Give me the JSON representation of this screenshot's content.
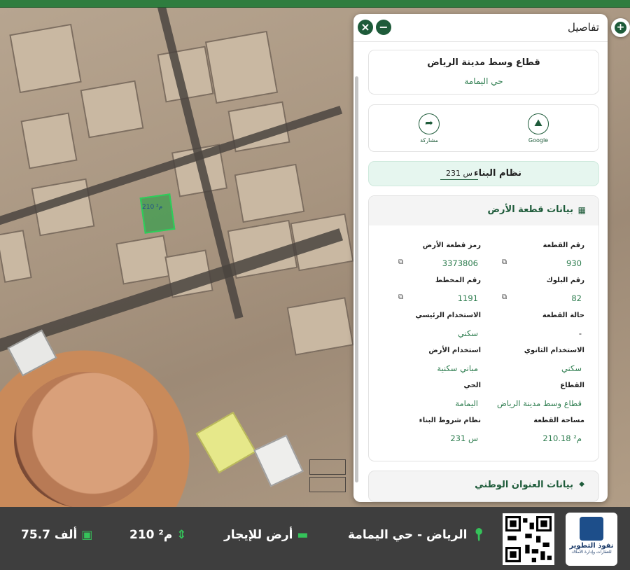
{
  "panel": {
    "title": "تفاصيل",
    "close_icon": "close-icon",
    "minimize_icon": "minus-icon",
    "sector_name": "قطاع وسط مدينة الرياض",
    "district_name": "حي اليمامة",
    "actions": [
      {
        "label": "Google",
        "icon": "map-icon"
      },
      {
        "label": "مشاركة",
        "icon": "share-icon"
      }
    ],
    "building_system": {
      "label": "نظام البناء",
      "value": "س 231"
    },
    "land": {
      "title": "بيانات قطعة الأرض",
      "fields": {
        "plot_number": {
          "label": "رقم القطعة",
          "value": "930"
        },
        "land_code": {
          "label": "رمز قطعة الأرض",
          "value": "3373806"
        },
        "block_number": {
          "label": "رقم البلوك",
          "value": "82"
        },
        "plan_number": {
          "label": "رقم المخطط",
          "value": "1191"
        },
        "plot_status": {
          "label": "حالة القطعة",
          "value": "-"
        },
        "main_use": {
          "label": "الاستخدام الرئيسي",
          "value": "سكني"
        },
        "secondary_use": {
          "label": "الاستخدام الثانوي",
          "value": "سكني"
        },
        "land_use": {
          "label": "استخدام الأرض",
          "value": "مباني سكنية"
        },
        "sector": {
          "label": "القطاع",
          "value": "قطاع وسط مدينة الرياض"
        },
        "district": {
          "label": "الحي",
          "value": "اليمامة"
        },
        "area": {
          "label": "مساحة القطعة",
          "value": "210.18 م²"
        },
        "building_terms": {
          "label": "نظام شروط البناء",
          "value": "س 231"
        }
      }
    },
    "address_title": "بيانات العنوان الوطني"
  },
  "map": {
    "plot_label": "210 م²"
  },
  "bottom": {
    "price": "75.7 ألف",
    "area": "210 م²",
    "type": "أرض للإيجار",
    "location": "الرياض - حي اليمامة",
    "logo_name": "نفوذ التطوير",
    "logo_sub": "للعقارات وإدارة الأملاك"
  },
  "colors": {
    "brand": "#1e5b3a",
    "accent": "#35c35a",
    "value": "#2e7d4f"
  }
}
